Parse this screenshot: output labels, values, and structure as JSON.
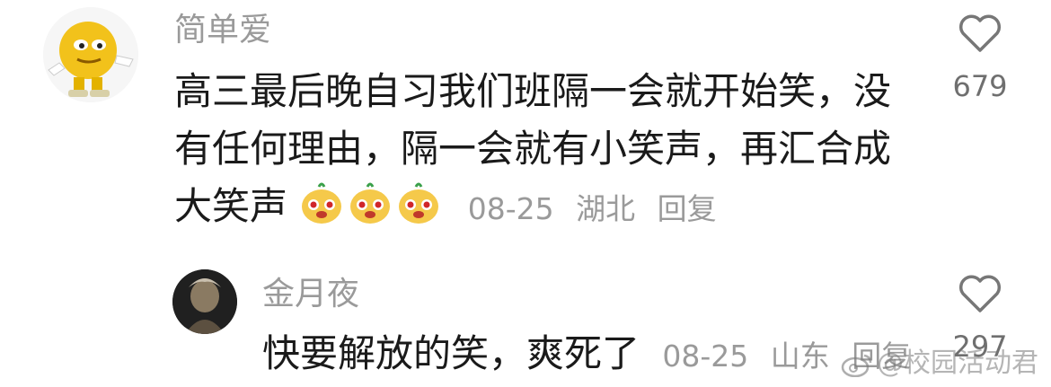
{
  "comments": [
    {
      "username": "简单爱",
      "lines": [
        "高三最后晚自习我们班隔一会就开始笑，没",
        "有任何理由，隔一会就有小笑声，再汇合成",
        "大笑声"
      ],
      "emojis": [
        "doge-emoji",
        "doge-emoji",
        "doge-emoji"
      ],
      "date": "08-25",
      "location": "湖北",
      "reply_label": "回复",
      "likes": "679"
    },
    {
      "username": "金月夜",
      "text": "快要解放的笑，爽死了",
      "date": "08-25",
      "location": "山东",
      "reply_label": "回复",
      "likes": "297"
    }
  ],
  "watermark": "@校园活动君",
  "colors": {
    "username": "#9a9a9a",
    "text": "#1a1a1a",
    "meta": "#9a9a9a",
    "like_icon": "#777777"
  },
  "icons": [
    "heart-icon",
    "weibo-logo-icon"
  ]
}
